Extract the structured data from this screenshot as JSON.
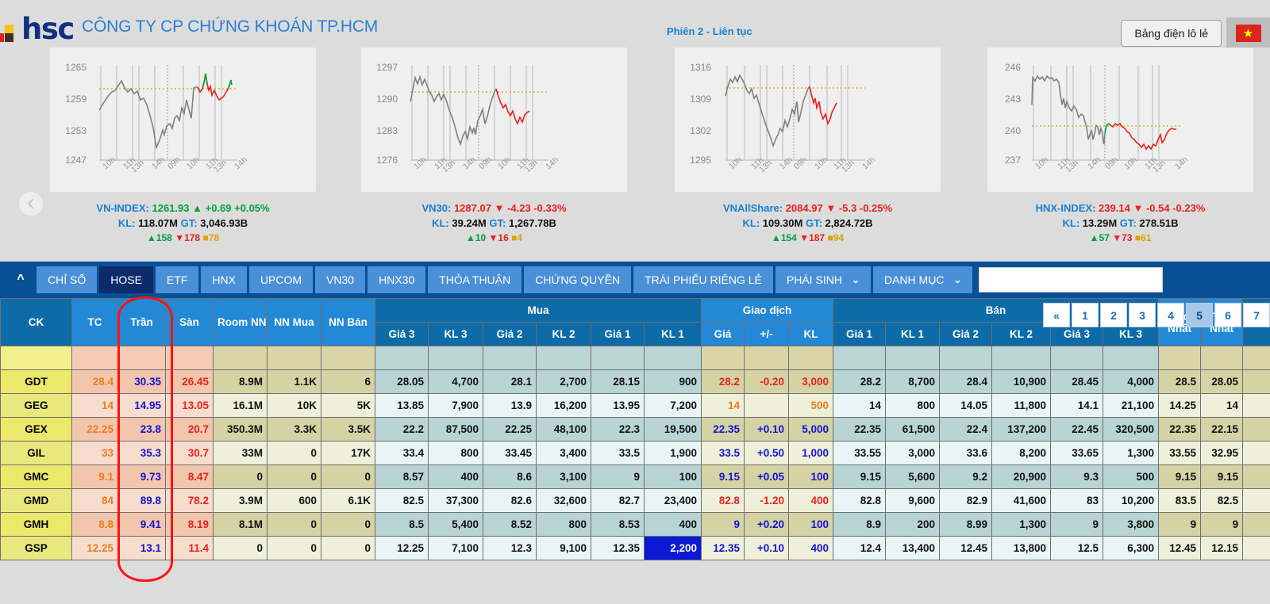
{
  "header": {
    "brand_text": "hsc",
    "company_name": "CÔNG TY CP CHỨNG KHOÁN TP.HCM",
    "session": "Phiên 2 - Liên tục",
    "odd_lot_button": "Bảng điện lô lẻ",
    "flag_icon": "vietnam-flag-icon"
  },
  "indices": [
    {
      "name": "VN-INDEX",
      "value": "1261.93",
      "dir": "up",
      "arrow": "▲",
      "change": "+0.69",
      "percent": "+0.05%",
      "vol_label": "KL:",
      "vol": "118.07M",
      "val_label": "GT:",
      "val": "3,046.93B",
      "advancers": "158",
      "decliners": "178",
      "unchanged": "78",
      "y_ticks": [
        "1265",
        "1259",
        "1253",
        "1247"
      ],
      "x_ticks": [
        "10h",
        "11h",
        "13h",
        "14h",
        "09h",
        "10h",
        "11h",
        "13h",
        "14h"
      ]
    },
    {
      "name": "VN30",
      "value": "1287.07",
      "dir": "down",
      "arrow": "▼",
      "change": "-4.23",
      "percent": "-0.33%",
      "vol_label": "KL:",
      "vol": "39.24M",
      "val_label": "GT:",
      "val": "1,267.78B",
      "advancers": "10",
      "decliners": "16",
      "unchanged": "4",
      "y_ticks": [
        "1297",
        "1290",
        "1283",
        "1276"
      ],
      "x_ticks": [
        "10h",
        "11h",
        "13h",
        "14h",
        "09h",
        "10h",
        "11h",
        "13h",
        "14h"
      ]
    },
    {
      "name": "VNAllShare",
      "value": "2084.97",
      "dir": "down",
      "arrow": "▼",
      "change": "-5.3",
      "percent": "-0.25%",
      "vol_label": "KL:",
      "vol": "109.30M",
      "val_label": "GT:",
      "val": "2,824.72B",
      "advancers": "154",
      "decliners": "187",
      "unchanged": "94",
      "y_ticks": [
        "1316",
        "1309",
        "1302",
        "1295"
      ],
      "x_ticks": [
        "10h",
        "11h",
        "13h",
        "14h",
        "09h",
        "10h",
        "11h",
        "13h",
        "14h"
      ]
    },
    {
      "name": "HNX-INDEX",
      "value": "239.14",
      "dir": "down",
      "arrow": "▼",
      "change": "-0.54",
      "percent": "-0.23%",
      "vol_label": "KL:",
      "vol": "13.29M",
      "val_label": "GT:",
      "val": "278.51B",
      "advancers": "57",
      "decliners": "73",
      "unchanged": "61",
      "y_ticks": [
        "246",
        "243",
        "240",
        "237"
      ],
      "x_ticks": [
        "10h",
        "11h",
        "13h",
        "14h",
        "09h",
        "10h",
        "11h",
        "13h",
        "14h"
      ]
    }
  ],
  "nav": {
    "collapse_icon": "chevron-up-icon",
    "tabs": [
      {
        "label": "CHỈ SỐ",
        "active": false
      },
      {
        "label": "HOSE",
        "active": true
      },
      {
        "label": "ETF",
        "active": false
      },
      {
        "label": "HNX",
        "active": false
      },
      {
        "label": "UPCOM",
        "active": false
      },
      {
        "label": "VN30",
        "active": false
      },
      {
        "label": "HNX30",
        "active": false
      },
      {
        "label": "THỎA THUẬN",
        "active": false
      },
      {
        "label": "CHỨNG QUYỀN",
        "active": false
      },
      {
        "label": "TRÁI PHIẾU RIÊNG LẺ",
        "active": false
      },
      {
        "label": "PHÁI SINH",
        "active": false,
        "caret": "⌄"
      },
      {
        "label": "DANH MỤC",
        "active": false,
        "caret": "⌄"
      }
    ],
    "search_value": "",
    "search_placeholder": ""
  },
  "pagination": {
    "prev_label": "«",
    "pages": [
      "1",
      "2",
      "3",
      "4",
      "5",
      "6",
      "7"
    ],
    "current": "5"
  },
  "table": {
    "group_headers": {
      "ck": "CK",
      "tc": "TC",
      "tran": "Trần",
      "san": "Sàn",
      "room_nn": "Room NN",
      "nn_mua": "NN Mua",
      "nn_ban": "NN Bán",
      "mua": "Mua",
      "giao_dich": "Giao dịch",
      "ban": "Bán",
      "cao_nhat": "Cao\nNhất",
      "thap_nhat": "Thấp\nNhất"
    },
    "sub_headers": {
      "gia3": "Giá 3",
      "kl3": "KL 3",
      "gia2": "Giá 2",
      "kl2": "KL 2",
      "gia1": "Giá 1",
      "kl1": "KL 1",
      "gia": "Giá",
      "pm": "+/-",
      "kl": "KL",
      "cao": "Cao",
      "nhat1": "Nhất",
      "thap": "Thấp",
      "nhat2": "Nhất"
    },
    "rows": [
      {
        "sym": "GDT",
        "tc": "28.4",
        "tran": "30.35",
        "san": "26.45",
        "room_nn": "8.9M",
        "nn_mua": "1.1K",
        "nn_ban": "6",
        "b_gia3": "28.05",
        "b_kl3": "4,700",
        "b_gia2": "28.1",
        "b_kl2": "2,700",
        "b_gia1": "28.15",
        "b_kl1": "900",
        "m_gia": "28.2",
        "m_pm": "-0.20",
        "m_kl": "3,000",
        "m_dir": "down",
        "s_gia1": "28.2",
        "s_kl1": "8,700",
        "s_gia2": "28.4",
        "s_kl2": "10,900",
        "s_gia3": "28.45",
        "s_kl3": "4,000",
        "cao": "28.5",
        "thap": "28.05",
        "sel": false
      },
      {
        "sym": "GEG",
        "tc": "14",
        "tran": "14.95",
        "san": "13.05",
        "room_nn": "16.1M",
        "nn_mua": "10K",
        "nn_ban": "5K",
        "b_gia3": "13.85",
        "b_kl3": "7,900",
        "b_gia2": "13.9",
        "b_kl2": "16,200",
        "b_gia1": "13.95",
        "b_kl1": "7,200",
        "m_gia": "14",
        "m_pm": "",
        "m_kl": "500",
        "m_dir": "flat",
        "s_gia1": "14",
        "s_kl1": "800",
        "s_gia2": "14.05",
        "s_kl2": "11,800",
        "s_gia3": "14.1",
        "s_kl3": "21,100",
        "cao": "14.25",
        "thap": "14",
        "sel": false
      },
      {
        "sym": "GEX",
        "tc": "22.25",
        "tran": "23.8",
        "san": "20.7",
        "room_nn": "350.3M",
        "nn_mua": "3.3K",
        "nn_ban": "3.5K",
        "b_gia3": "22.2",
        "b_kl3": "87,500",
        "b_gia2": "22.25",
        "b_kl2": "48,100",
        "b_gia1": "22.3",
        "b_kl1": "19,500",
        "m_gia": "22.35",
        "m_pm": "+0.10",
        "m_kl": "5,000",
        "m_dir": "up",
        "s_gia1": "22.35",
        "s_kl1": "61,500",
        "s_gia2": "22.4",
        "s_kl2": "137,200",
        "s_gia3": "22.45",
        "s_kl3": "320,500",
        "cao": "22.35",
        "thap": "22.15",
        "sel": false
      },
      {
        "sym": "GIL",
        "tc": "33",
        "tran": "35.3",
        "san": "30.7",
        "room_nn": "33M",
        "nn_mua": "0",
        "nn_ban": "17K",
        "b_gia3": "33.4",
        "b_kl3": "800",
        "b_gia2": "33.45",
        "b_kl2": "3,400",
        "b_gia1": "33.5",
        "b_kl1": "1,900",
        "m_gia": "33.5",
        "m_pm": "+0.50",
        "m_kl": "1,000",
        "m_dir": "up",
        "s_gia1": "33.55",
        "s_kl1": "3,000",
        "s_gia2": "33.6",
        "s_kl2": "8,200",
        "s_gia3": "33.65",
        "s_kl3": "1,300",
        "cao": "33.55",
        "thap": "32.95",
        "sel": false
      },
      {
        "sym": "GMC",
        "tc": "9.1",
        "tran": "9.73",
        "san": "8.47",
        "room_nn": "0",
        "nn_mua": "0",
        "nn_ban": "0",
        "b_gia3": "8.57",
        "b_kl3": "400",
        "b_gia2": "8.6",
        "b_kl2": "3,100",
        "b_gia1": "9",
        "b_kl1": "100",
        "m_gia": "9.15",
        "m_pm": "+0.05",
        "m_kl": "100",
        "m_dir": "up",
        "s_gia1": "9.15",
        "s_kl1": "5,600",
        "s_gia2": "9.2",
        "s_kl2": "20,900",
        "s_gia3": "9.3",
        "s_kl3": "500",
        "cao": "9.15",
        "thap": "9.15",
        "sel": false
      },
      {
        "sym": "GMD",
        "tc": "84",
        "tran": "89.8",
        "san": "78.2",
        "room_nn": "3.9M",
        "nn_mua": "600",
        "nn_ban": "6.1K",
        "b_gia3": "82.5",
        "b_kl3": "37,300",
        "b_gia2": "82.6",
        "b_kl2": "32,600",
        "b_gia1": "82.7",
        "b_kl1": "23,400",
        "m_gia": "82.8",
        "m_pm": "-1.20",
        "m_kl": "400",
        "m_dir": "down",
        "s_gia1": "82.8",
        "s_kl1": "9,600",
        "s_gia2": "82.9",
        "s_kl2": "41,600",
        "s_gia3": "83",
        "s_kl3": "10,200",
        "cao": "83.5",
        "thap": "82.5",
        "sel": false
      },
      {
        "sym": "GMH",
        "tc": "8.8",
        "tran": "9.41",
        "san": "8.19",
        "room_nn": "8.1M",
        "nn_mua": "0",
        "nn_ban": "0",
        "b_gia3": "8.5",
        "b_kl3": "5,400",
        "b_gia2": "8.52",
        "b_kl2": "800",
        "b_gia1": "8.53",
        "b_kl1": "400",
        "m_gia": "9",
        "m_pm": "+0.20",
        "m_kl": "100",
        "m_dir": "up",
        "s_gia1": "8.9",
        "s_kl1": "200",
        "s_gia2": "8.99",
        "s_kl2": "1,300",
        "s_gia3": "9",
        "s_kl3": "3,800",
        "cao": "9",
        "thap": "9",
        "sel": false
      },
      {
        "sym": "GSP",
        "tc": "12.25",
        "tran": "13.1",
        "san": "11.4",
        "room_nn": "0",
        "nn_mua": "0",
        "nn_ban": "0",
        "b_gia3": "12.25",
        "b_kl3": "7,100",
        "b_gia2": "12.3",
        "b_kl2": "9,100",
        "b_gia1": "12.35",
        "b_kl1": "2,200",
        "m_gia": "12.35",
        "m_pm": "+0.10",
        "m_kl": "400",
        "m_dir": "up",
        "s_gia1": "12.4",
        "s_kl1": "13,400",
        "s_gia2": "12.45",
        "s_kl2": "13,800",
        "s_gia3": "12.5",
        "s_kl3": "6,300",
        "cao": "12.45",
        "thap": "12.15",
        "sel": true
      }
    ]
  },
  "annotation": {
    "target": "tran-column",
    "color": "#ff1111"
  }
}
